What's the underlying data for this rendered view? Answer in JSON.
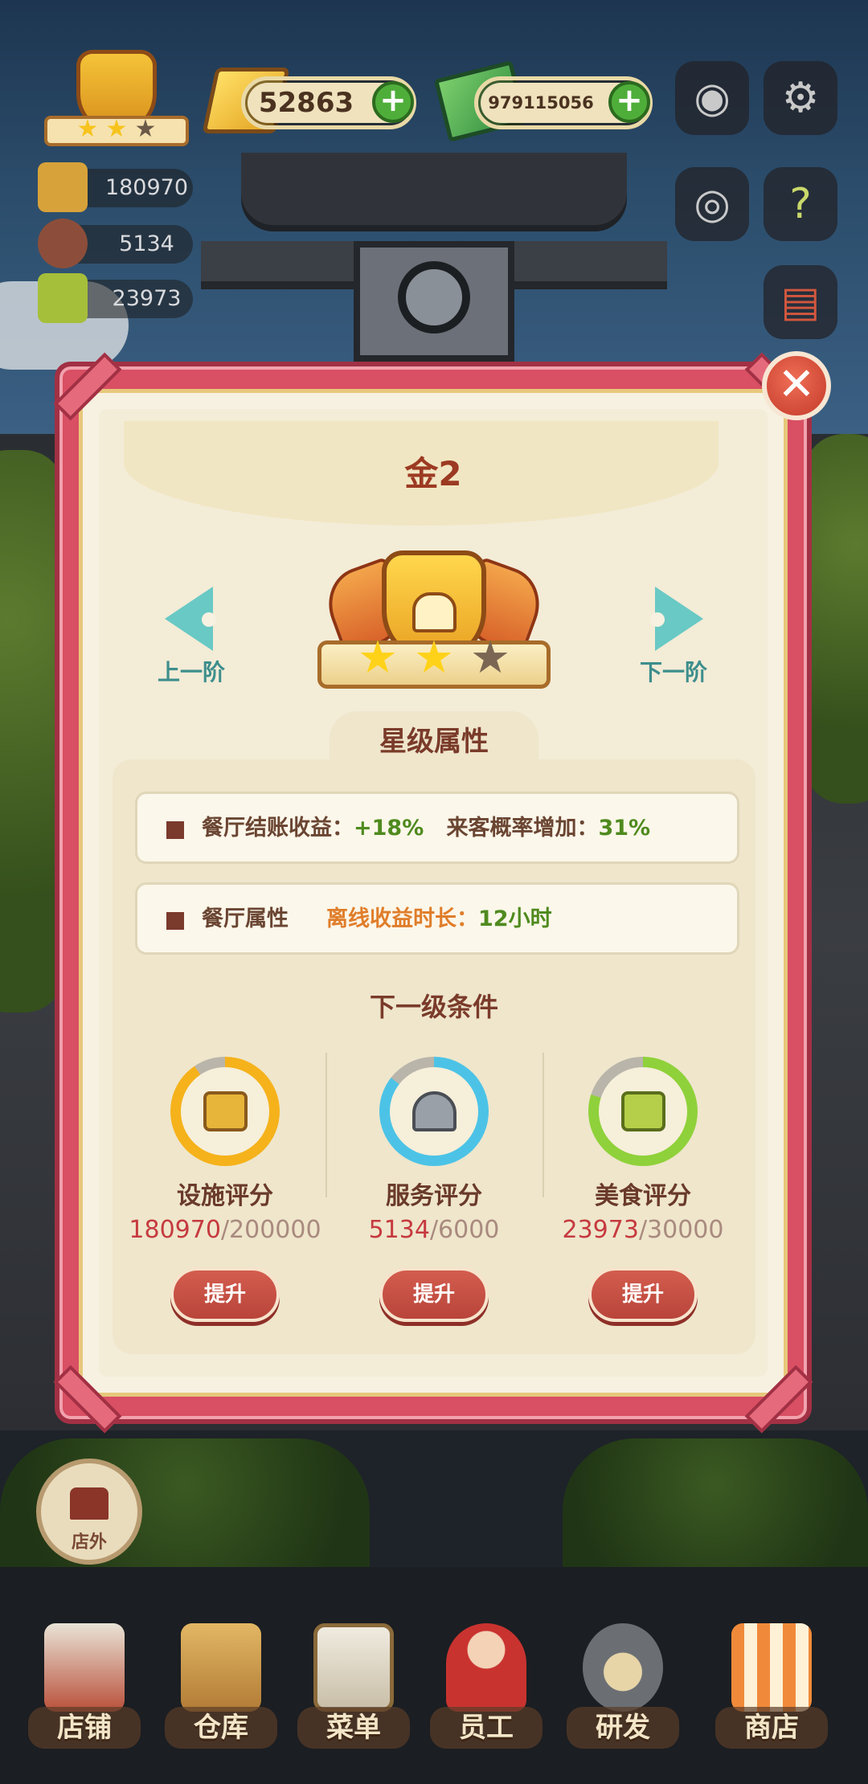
{
  "hud": {
    "gold": "52863",
    "cash": "979115056",
    "facility_score": "180970",
    "service_score": "5134",
    "food_score": "23973",
    "rank_stars_filled": 2,
    "rank_stars_total": 3
  },
  "dialog": {
    "title": "金2",
    "prev_label": "上一阶",
    "next_label": "下一阶",
    "close_symbol": "✕",
    "section_title": "星级属性",
    "attributes": [
      {
        "name": "餐厅结账收益：",
        "value": "+18%",
        "name2": "来客概率增加：",
        "value2": "31%"
      },
      {
        "name": "餐厅属性",
        "sub": "离线收益时长：",
        "value": "12小时"
      }
    ],
    "conditions_title": "下一级条件",
    "conditions": [
      {
        "label": "设施评分",
        "current": "180970",
        "target": "/200000",
        "progress": 0.905,
        "ring_color": "#f5b21b",
        "icon": "facility-icon",
        "button": "提升"
      },
      {
        "label": "服务评分",
        "current": "5134",
        "target": "/6000",
        "progress": 0.856,
        "ring_color": "#4cc3e6",
        "icon": "service-cloche-icon",
        "button": "提升"
      },
      {
        "label": "美食评分",
        "current": "23973",
        "target": "/30000",
        "progress": 0.799,
        "ring_color": "#8fd13a",
        "icon": "recipe-book-icon",
        "button": "提升"
      }
    ]
  },
  "outside_button": "店外",
  "bottom_nav": [
    {
      "label": "店铺",
      "icon": "shop-icon"
    },
    {
      "label": "仓库",
      "icon": "warehouse-icon"
    },
    {
      "label": "菜单",
      "icon": "menu-icon"
    },
    {
      "label": "员工",
      "icon": "staff-icon"
    },
    {
      "label": "研发",
      "icon": "research-icon"
    },
    {
      "label": "商店",
      "icon": "store-icon"
    }
  ],
  "colors": {
    "dialog_frame": "#d94f63",
    "title_text": "#9c3a22",
    "progress_red": "#c63a3f",
    "highlight_green": "#4f8a1e",
    "highlight_orange": "#e07d2a"
  }
}
